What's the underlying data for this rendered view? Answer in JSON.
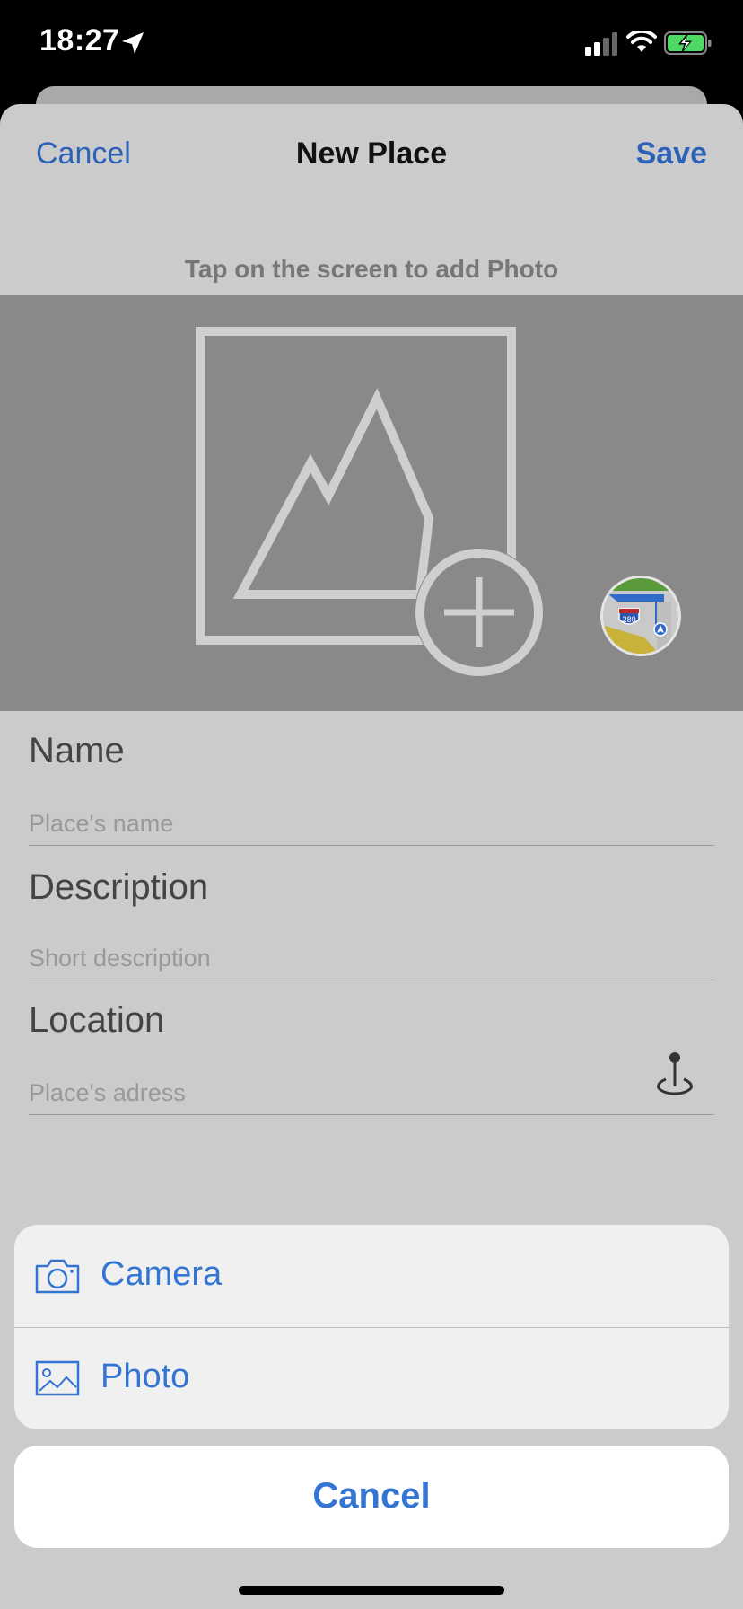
{
  "status_bar": {
    "time": "18:27"
  },
  "nav": {
    "cancel_label": "Cancel",
    "title": "New Place",
    "save_label": "Save"
  },
  "photo": {
    "hint": "Tap on the screen to add Photo",
    "maps_badge": "280"
  },
  "form": {
    "name_label": "Name",
    "name_placeholder": "Place's name",
    "description_label": "Description",
    "description_placeholder": "Short description",
    "location_label": "Location",
    "location_placeholder": "Place's adress"
  },
  "action_sheet": {
    "items": [
      {
        "label": "Camera",
        "icon": "camera-icon"
      },
      {
        "label": "Photo",
        "icon": "photo-icon"
      }
    ],
    "cancel_label": "Cancel"
  },
  "colors": {
    "accent": "#3475d4",
    "sheet_background": "#cbcbcb",
    "photo_area": "#898989"
  }
}
